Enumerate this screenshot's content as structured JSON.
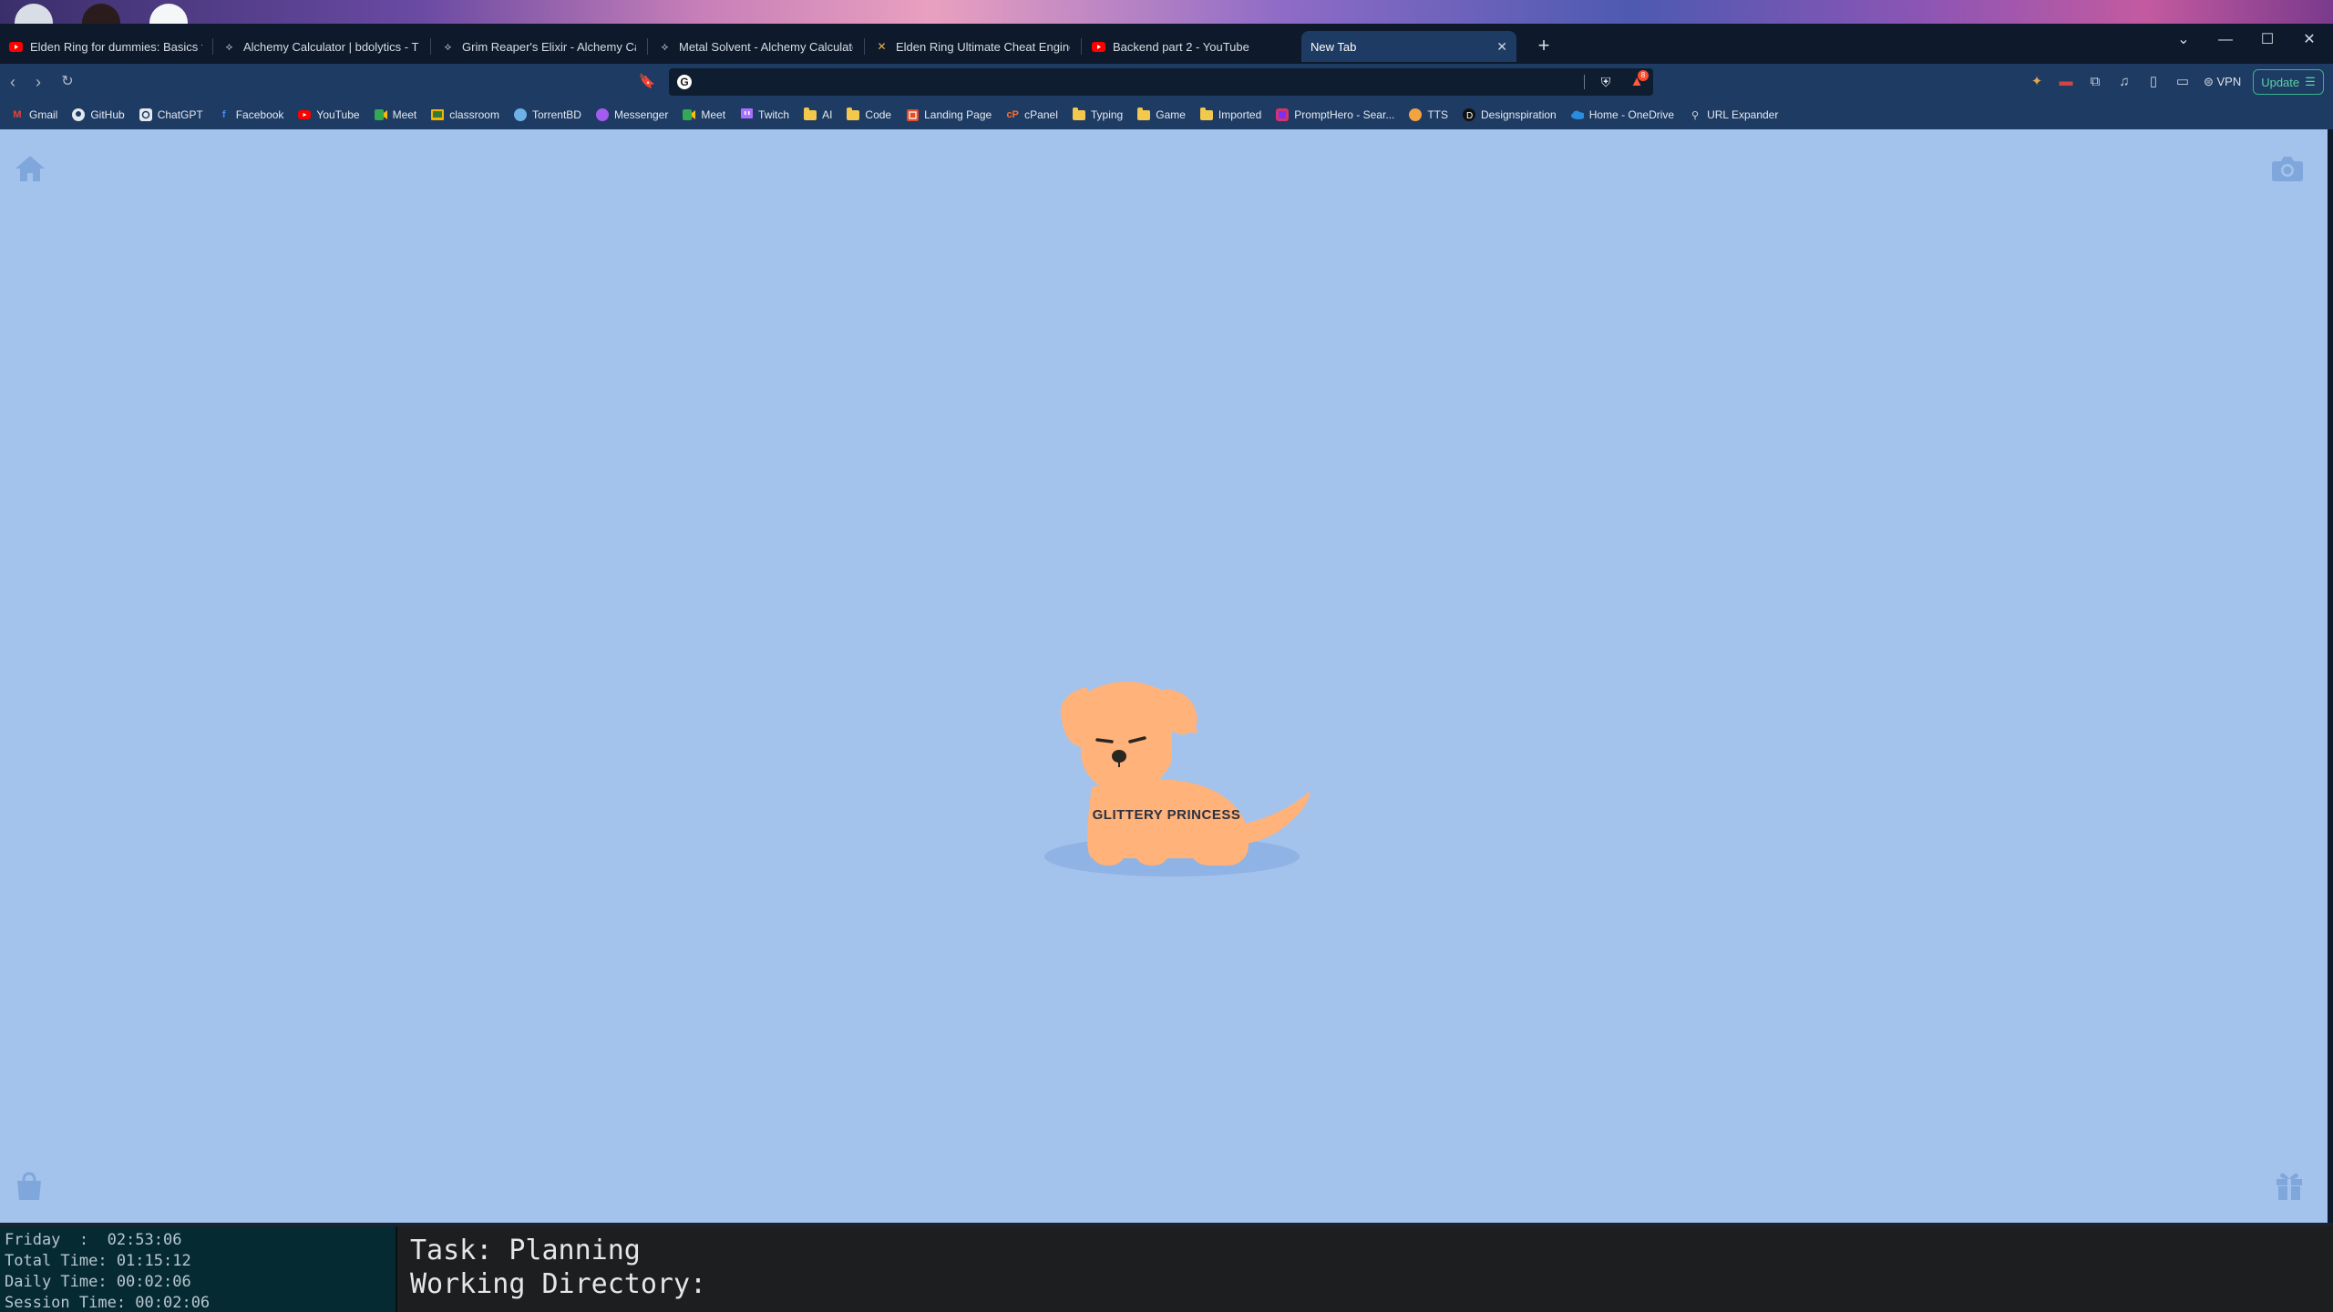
{
  "tabs": [
    {
      "label": "Elden Ring for dummies: Basics for E",
      "favicon": "youtube-icon"
    },
    {
      "label": "Alchemy Calculator | bdolytics - The",
      "favicon": "bdolytics-icon"
    },
    {
      "label": "Grim Reaper's Elixir - Alchemy Calcu",
      "favicon": "bdolytics-icon"
    },
    {
      "label": "Metal Solvent - Alchemy Calculator |",
      "favicon": "bdolytics-icon"
    },
    {
      "label": "Elden Ring Ultimate Cheat Engine Ta",
      "favicon": "cheat-engine-icon"
    },
    {
      "label": "Backend part 2 - YouTube",
      "favicon": "youtube-icon"
    },
    {
      "label": "New Tab",
      "favicon": "",
      "active": true
    }
  ],
  "toolbar": {
    "url_value": "",
    "rewards_count": "8",
    "vpn_label": "VPN",
    "update_label": "Update"
  },
  "bookmarks": [
    {
      "label": "Gmail",
      "icon": "gmail-icon"
    },
    {
      "label": "GitHub",
      "icon": "github-icon"
    },
    {
      "label": "ChatGPT",
      "icon": "chatgpt-icon"
    },
    {
      "label": "Facebook",
      "icon": "facebook-icon"
    },
    {
      "label": "YouTube",
      "icon": "youtube-icon"
    },
    {
      "label": "Meet",
      "icon": "meet-icon"
    },
    {
      "label": "classroom",
      "icon": "classroom-icon"
    },
    {
      "label": "TorrentBD",
      "icon": "torrentbd-icon"
    },
    {
      "label": "Messenger",
      "icon": "messenger-icon"
    },
    {
      "label": "Meet",
      "icon": "meet-icon"
    },
    {
      "label": "Twitch",
      "icon": "twitch-icon"
    },
    {
      "label": "AI",
      "icon": "folder-icon"
    },
    {
      "label": "Code",
      "icon": "folder-icon"
    },
    {
      "label": "Landing Page",
      "icon": "html-icon"
    },
    {
      "label": "cPanel",
      "icon": "cpanel-icon"
    },
    {
      "label": "Typing",
      "icon": "folder-icon"
    },
    {
      "label": "Game",
      "icon": "folder-icon"
    },
    {
      "label": "Imported",
      "icon": "folder-icon"
    },
    {
      "label": "PromptHero - Sear...",
      "icon": "prompthero-icon"
    },
    {
      "label": "TTS",
      "icon": "tts-icon"
    },
    {
      "label": "Designspiration",
      "icon": "designspiration-icon"
    },
    {
      "label": "Home - OneDrive",
      "icon": "onedrive-icon"
    },
    {
      "label": "URL Expander",
      "icon": "url-expander-icon"
    }
  ],
  "newtab": {
    "pet_name": "GLITTERY PRINCESS"
  },
  "status_pane": {
    "day_line": "Friday  :  02:53:06",
    "total_line": "Total Time: 01:15:12",
    "daily_line": "Daily Time: 00:02:06",
    "session_line": "Session Time: 00:02:06"
  },
  "task_pane": {
    "task_line": "Task: Planning",
    "dir_line": "Working Directory:"
  },
  "colors": {
    "page_bg": "#a4c3ec",
    "dog": "#ffb27a",
    "accent_update": "#38b48b"
  }
}
